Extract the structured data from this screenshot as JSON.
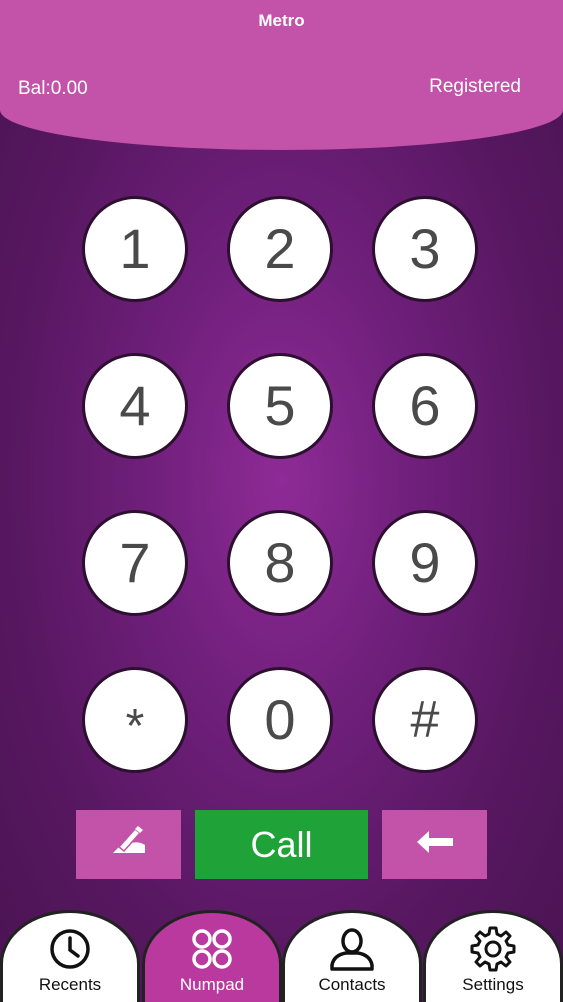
{
  "header": {
    "title": "Metro",
    "balance": "Bal:0.00",
    "status": "Registered"
  },
  "keypad": {
    "keys": [
      "1",
      "2",
      "3",
      "4",
      "5",
      "6",
      "7",
      "8",
      "9",
      "*",
      "0",
      "#"
    ]
  },
  "actions": {
    "call_label": "Call",
    "left_icon": "hand-writing-icon",
    "right_icon": "backspace-arrow-icon"
  },
  "tabs": [
    {
      "label": "Recents",
      "icon": "clock-icon"
    },
    {
      "label": "Numpad",
      "icon": "four-dots-icon"
    },
    {
      "label": "Contacts",
      "icon": "person-icon"
    },
    {
      "label": "Settings",
      "icon": "gear-icon"
    }
  ],
  "colors": {
    "header": "#c352a9",
    "background": "#6e1f7a",
    "call": "#1fa339",
    "active_tab": "#b9399f"
  }
}
